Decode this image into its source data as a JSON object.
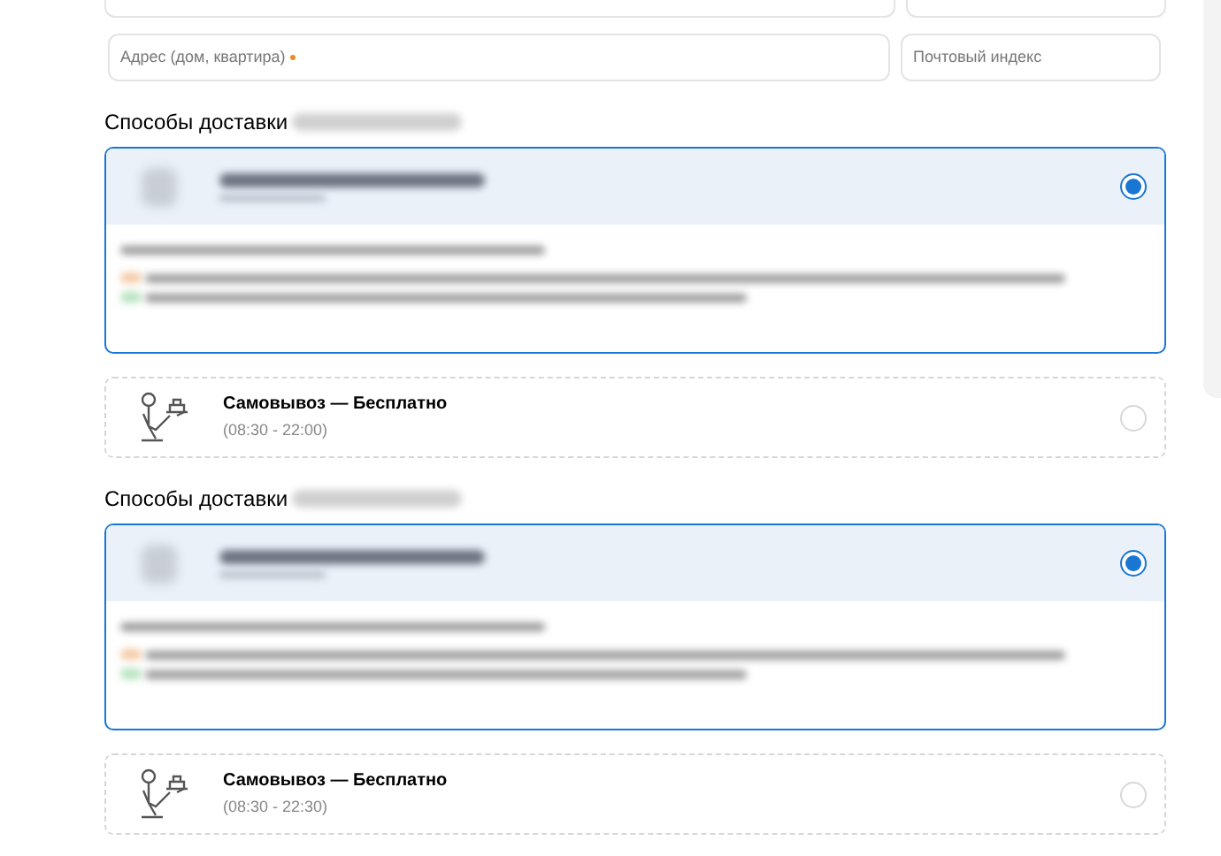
{
  "address_fields": [
    {
      "placeholder": "Адрес (дом, квартира)",
      "required": true
    },
    {
      "placeholder": "Почтовый индекс",
      "required": false
    }
  ],
  "sections": [
    {
      "heading": "Способы доставки",
      "options": [
        {
          "kind": "hidden",
          "selected": true
        },
        {
          "kind": "pickup",
          "title": "Самовывоз — Бесплатно",
          "hours": "(08:30 - 22:00)",
          "selected": false
        }
      ]
    },
    {
      "heading": "Способы доставки",
      "options": [
        {
          "kind": "hidden",
          "selected": true
        },
        {
          "kind": "pickup",
          "title": "Самовывоз — Бесплатно",
          "hours": "(08:30 - 22:30)",
          "selected": false
        }
      ]
    }
  ]
}
